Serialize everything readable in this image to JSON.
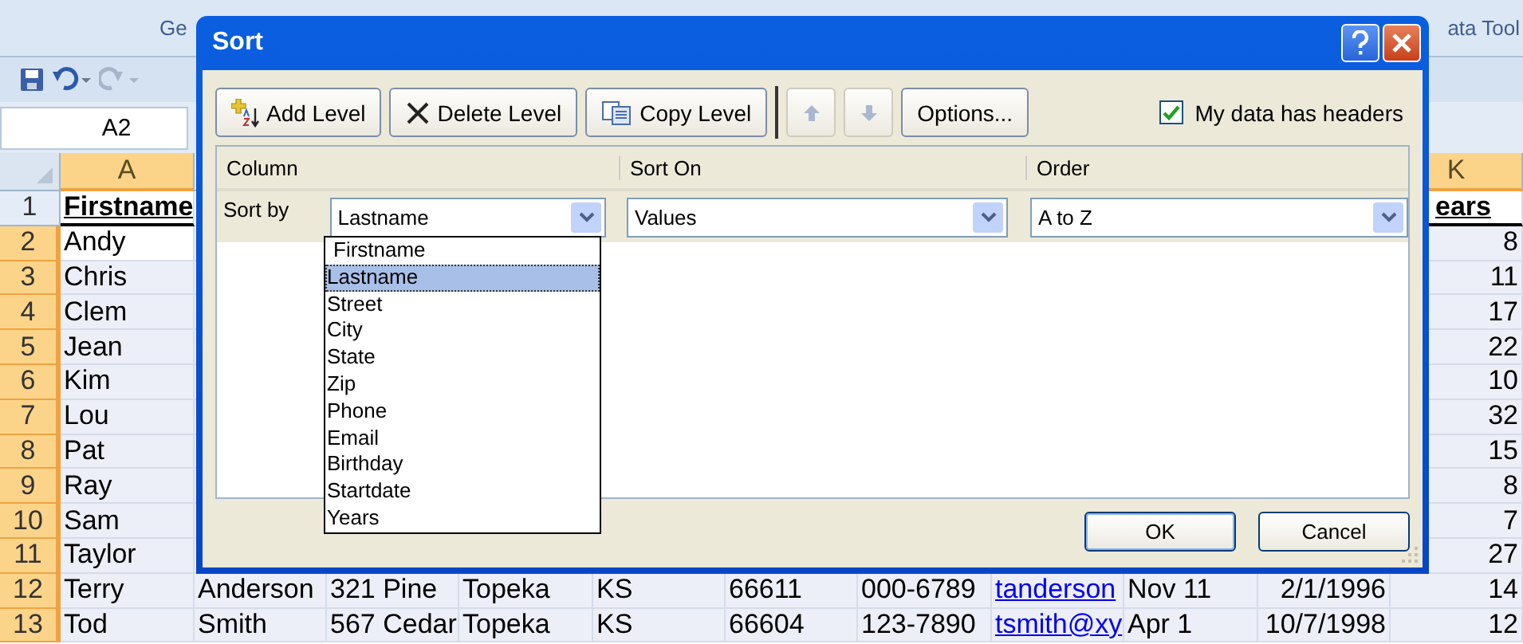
{
  "ribbon": {
    "group_labels": [
      "Ge",
      "ata Tool"
    ]
  },
  "name_box": "A2",
  "sheet": {
    "columns": [
      {
        "label": "A",
        "selected": true
      },
      {
        "label": "K",
        "selected": true
      }
    ],
    "rows": [
      {
        "number": "1",
        "selected": false,
        "active": false,
        "kind": "header",
        "cells": [
          {
            "text": "Firstname",
            "kind": "text"
          },
          {
            "text": "ears",
            "kind": "text"
          }
        ]
      },
      {
        "number": "2",
        "selected": true,
        "active": true,
        "kind": "partial",
        "cells": [
          {
            "text": "Andy",
            "kind": "text"
          },
          {
            "text": "8",
            "kind": "number"
          }
        ]
      },
      {
        "number": "3",
        "selected": true,
        "active": false,
        "kind": "partial",
        "cells": [
          {
            "text": "Chris",
            "kind": "text"
          },
          {
            "text": "11",
            "kind": "number"
          }
        ]
      },
      {
        "number": "4",
        "selected": true,
        "active": false,
        "kind": "partial",
        "cells": [
          {
            "text": "Clem",
            "kind": "text"
          },
          {
            "text": "17",
            "kind": "number"
          }
        ]
      },
      {
        "number": "5",
        "selected": true,
        "active": false,
        "kind": "partial",
        "cells": [
          {
            "text": "Jean",
            "kind": "text"
          },
          {
            "text": "22",
            "kind": "number"
          }
        ]
      },
      {
        "number": "6",
        "selected": true,
        "active": false,
        "kind": "partial",
        "cells": [
          {
            "text": "Kim",
            "kind": "text"
          },
          {
            "text": "10",
            "kind": "number"
          }
        ]
      },
      {
        "number": "7",
        "selected": true,
        "active": false,
        "kind": "partial",
        "cells": [
          {
            "text": "Lou",
            "kind": "text"
          },
          {
            "text": "32",
            "kind": "number"
          }
        ]
      },
      {
        "number": "8",
        "selected": true,
        "active": false,
        "kind": "partial",
        "cells": [
          {
            "text": "Pat",
            "kind": "text"
          },
          {
            "text": "15",
            "kind": "number"
          }
        ]
      },
      {
        "number": "9",
        "selected": true,
        "active": false,
        "kind": "partial",
        "cells": [
          {
            "text": "Ray",
            "kind": "text"
          },
          {
            "text": "8",
            "kind": "number"
          }
        ]
      },
      {
        "number": "10",
        "selected": true,
        "active": false,
        "kind": "partial",
        "cells": [
          {
            "text": "Sam",
            "kind": "text"
          },
          {
            "text": "7",
            "kind": "number"
          }
        ]
      },
      {
        "number": "11",
        "selected": true,
        "active": false,
        "kind": "partial",
        "cells": [
          {
            "text": "Taylor",
            "kind": "text"
          },
          {
            "text": "27",
            "kind": "number"
          }
        ]
      },
      {
        "number": "12",
        "selected": true,
        "active": false,
        "kind": "full",
        "cells": [
          {
            "text": "Terry",
            "kind": "text"
          },
          {
            "text": "Anderson",
            "kind": "text"
          },
          {
            "text": "321 Pine",
            "kind": "text"
          },
          {
            "text": "Topeka",
            "kind": "text"
          },
          {
            "text": "KS",
            "kind": "text"
          },
          {
            "text": "66611",
            "kind": "text"
          },
          {
            "text": "000-6789",
            "kind": "text"
          },
          {
            "text": "tanderson",
            "kind": "link"
          },
          {
            "text": "Nov 11",
            "kind": "text"
          },
          {
            "text": "2/1/1996",
            "kind": "number"
          },
          {
            "text": "14",
            "kind": "number"
          }
        ]
      },
      {
        "number": "13",
        "selected": true,
        "active": false,
        "kind": "full",
        "cells": [
          {
            "text": "Tod",
            "kind": "text"
          },
          {
            "text": "Smith",
            "kind": "text"
          },
          {
            "text": "567 Cedar",
            "kind": "text"
          },
          {
            "text": "Topeka",
            "kind": "text"
          },
          {
            "text": "KS",
            "kind": "text"
          },
          {
            "text": "66604",
            "kind": "text"
          },
          {
            "text": "123-7890",
            "kind": "text"
          },
          {
            "text": "tsmith@xy",
            "kind": "link"
          },
          {
            "text": "Apr 1",
            "kind": "text"
          },
          {
            "text": "10/7/1998",
            "kind": "number"
          },
          {
            "text": "12",
            "kind": "number"
          }
        ]
      }
    ]
  },
  "dialog": {
    "title": "Sort",
    "toolbar": [
      {
        "kind": "add",
        "label": "Add Level",
        "disabled": false
      },
      {
        "kind": "delete",
        "label": "Delete Level",
        "disabled": false
      },
      {
        "kind": "copy",
        "label": "Copy Level",
        "disabled": false
      },
      {
        "kind": "up",
        "disabled": true
      },
      {
        "kind": "down",
        "disabled": true
      },
      {
        "kind": "options",
        "label": "Options...",
        "disabled": false
      }
    ],
    "headers_checkbox": {
      "label": "My data has headers",
      "checked": true
    },
    "columns": [
      "Column",
      "Sort On",
      "Order"
    ],
    "levels": [
      {
        "label": "Sort by",
        "column": "Lastname",
        "sort_on": "Values",
        "order": "A to Z"
      }
    ],
    "dropdown": {
      "items": [
        {
          "label": "Firstname",
          "selected": false
        },
        {
          "label": "Lastname",
          "selected": true
        },
        {
          "label": "Street",
          "selected": false
        },
        {
          "label": "City",
          "selected": false
        },
        {
          "label": "State",
          "selected": false
        },
        {
          "label": "Zip",
          "selected": false
        },
        {
          "label": "Phone",
          "selected": false
        },
        {
          "label": "Email",
          "selected": false
        },
        {
          "label": "Birthday",
          "selected": false
        },
        {
          "label": "Startdate",
          "selected": false
        },
        {
          "label": "Years",
          "selected": false
        }
      ]
    },
    "buttons": [
      {
        "kind": "ok",
        "label": "OK"
      },
      {
        "kind": "cancel",
        "label": "Cancel"
      }
    ]
  }
}
